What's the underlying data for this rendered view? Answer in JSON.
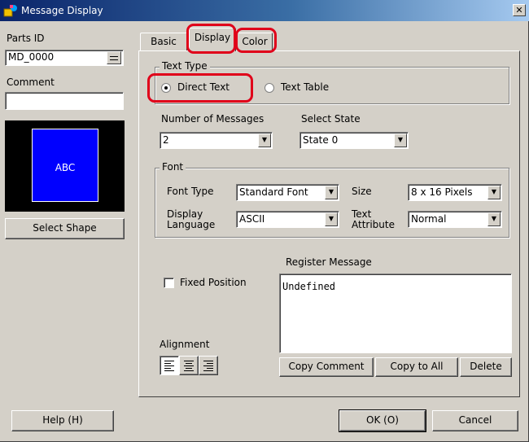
{
  "window": {
    "title": "Message Display"
  },
  "left": {
    "parts_id_label": "Parts ID",
    "parts_id_value": "MD_0000",
    "comment_label": "Comment",
    "comment_value": "",
    "preview_text": "ABC",
    "select_shape_label": "Select Shape"
  },
  "tabs": [
    {
      "label": "Basic",
      "selected": false
    },
    {
      "label": "Display",
      "selected": true
    },
    {
      "label": "Color",
      "selected": false
    }
  ],
  "text_type": {
    "group_label": "Text Type",
    "options": [
      {
        "label": "Direct Text",
        "checked": true
      },
      {
        "label": "Text Table",
        "checked": false
      }
    ]
  },
  "messages": {
    "count_label": "Number of Messages",
    "count_value": "2",
    "state_label": "Select State",
    "state_value": "State 0"
  },
  "font": {
    "group_label": "Font",
    "type_label": "Font Type",
    "type_value": "Standard Font",
    "size_label": "Size",
    "size_value": "8 x 16 Pixels",
    "lang_label_1": "Display",
    "lang_label_2": "Language",
    "lang_value": "ASCII",
    "attr_label_1": "Text",
    "attr_label_2": "Attribute",
    "attr_value": "Normal"
  },
  "register": {
    "label": "Register Message",
    "text": "Undefined",
    "fixed_position_label": "Fixed Position",
    "fixed_position_checked": false,
    "alignment_label": "Alignment",
    "copy_comment_label": "Copy Comment",
    "copy_all_label": "Copy to All",
    "delete_label": "Delete"
  },
  "footer": {
    "help_label": "Help (H)",
    "ok_label": "OK (O)",
    "cancel_label": "Cancel"
  },
  "colors": {
    "title_start": "#0a246a",
    "preview_bg": "#000000",
    "preview_shape": "#0000ff",
    "highlight": "#e0001a"
  },
  "icons": {
    "app": "app-icon",
    "close": "close-icon",
    "dropdown": "chevron-down-icon",
    "spinner": "spinner-icon",
    "align_left": "align-left-icon",
    "align_center": "align-center-icon",
    "align_right": "align-right-icon"
  }
}
